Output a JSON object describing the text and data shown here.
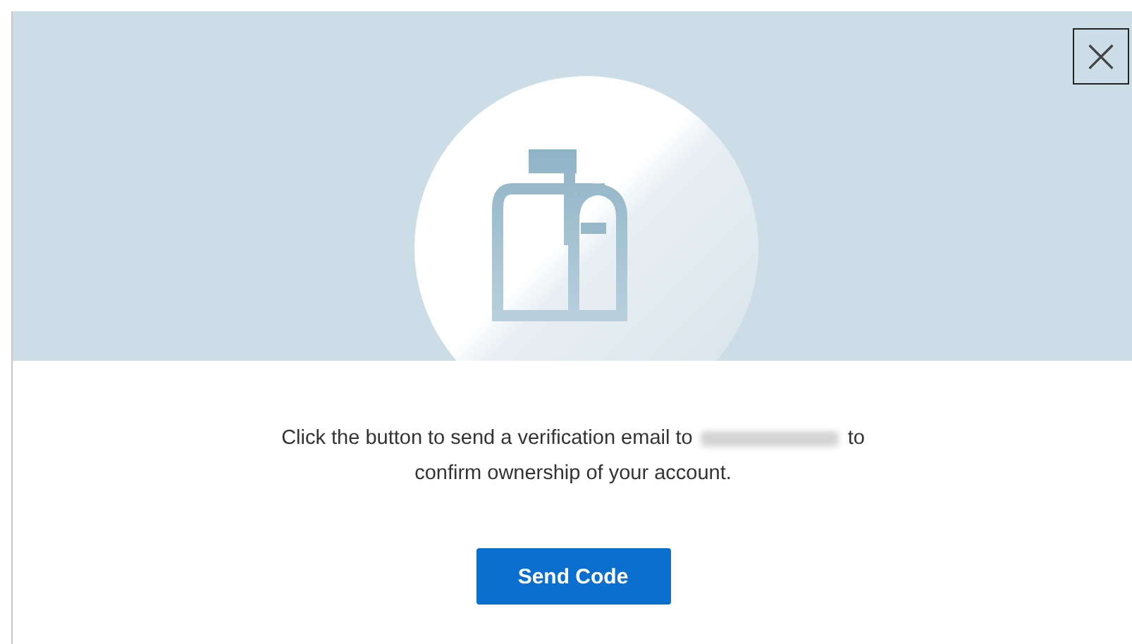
{
  "dialog": {
    "close_label": "×",
    "message_line1": "Click the button to send a verification email to",
    "message_line1_end": "to",
    "message_line2": "confirm ownership of your account.",
    "button": "Send Code"
  }
}
